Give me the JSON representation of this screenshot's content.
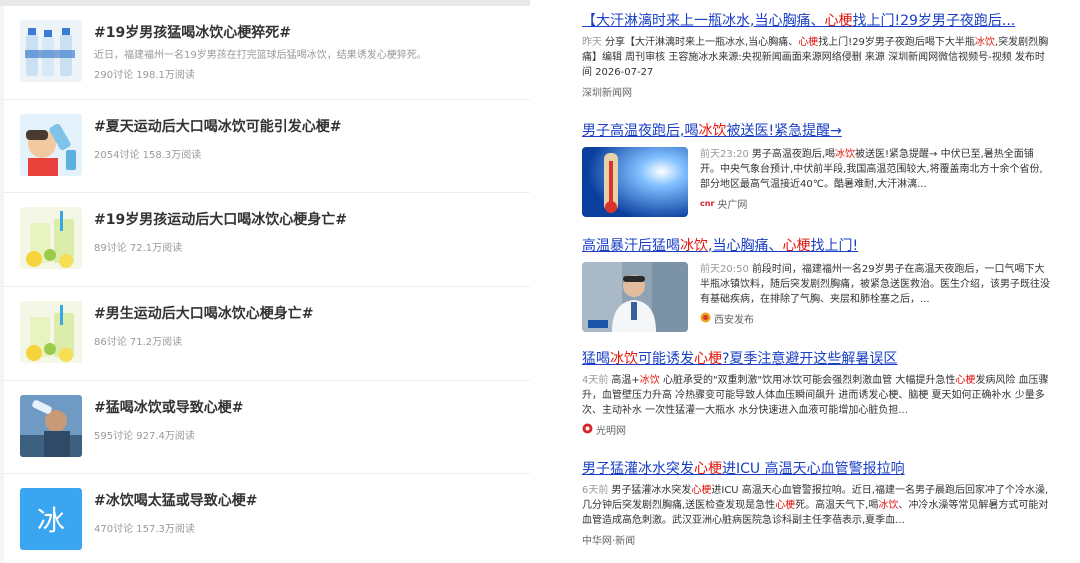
{
  "topics": [
    {
      "title": "#19岁男孩猛喝冰饮心梗猝死#",
      "desc": "近日，福建福州一名19岁男孩在打完篮球后猛喝冰饮，结果诱发心梗猝死。",
      "stats": "290讨论 198.1万阅读",
      "thumb": "water-bottles"
    },
    {
      "title": "#夏天运动后大口喝冰饮可能引发心梗#",
      "desc": "",
      "stats": "2054讨论 158.3万阅读",
      "thumb": "drinking-illustration"
    },
    {
      "title": "#19岁男孩运动后大口喝冰饮心梗身亡#",
      "desc": "",
      "stats": "89讨论 72.1万阅读",
      "thumb": "lemonade"
    },
    {
      "title": "#男生运动后大口喝冰饮心梗身亡#",
      "desc": "",
      "stats": "86讨论 71.2万阅读",
      "thumb": "lemonade"
    },
    {
      "title": "#猛喝冰饮或导致心梗#",
      "desc": "",
      "stats": "595讨论 927.4万阅读",
      "thumb": "man-drinking"
    },
    {
      "title": "#冰饮喝太猛或导致心梗#",
      "desc": "",
      "stats": "470讨论 157.3万阅读",
      "thumb": "ice-char",
      "thumb_char": "冰"
    }
  ],
  "news": [
    {
      "title_parts": [
        "【大汗淋漓时来上一瓶冰水,当心胸痛、",
        "心梗",
        "找上门!29岁男子夜跑后..."
      ],
      "time": "昨天",
      "body_parts": [
        "分享【大汗淋漓时来上一瓶冰水,当心胸痛、",
        "心梗",
        "找上门!29岁男子夜跑后喝下大半瓶",
        "冰饮",
        ",突发剧烈胸痛】编辑 周刊审核 王容施冰水来源:央视新闻画面来源网络侵删 来源 深圳新闻网微信视频号-视频 发布时间 2026-07-27"
      ],
      "source": "深圳新闻网"
    },
    {
      "title_parts": [
        "男子高温夜跑后,喝",
        "冰饮",
        "被送医!紧急提醒→"
      ],
      "time": "前天23:20",
      "body_parts": [
        "男子高温夜跑后,喝",
        "冰饮",
        "被送医!紧急提醒→ 中伏已至,暑热全面铺开。中央气象台预计,中伏前半段,我国高温范围较大,将覆盖南北方十余个省份,部分地区最高气温接近40℃。酷暑难耐,大汗淋漓..."
      ],
      "source": "央广网",
      "source_badge": "cnr",
      "image": "thermometer"
    },
    {
      "title_parts": [
        "高温暴汗后猛喝",
        "冰饮",
        ",当心胸痛、",
        "心梗",
        "找上门!"
      ],
      "time": "前天20:50",
      "body_parts": [
        "前段时间，福建福州一名29岁男子在高温天夜跑后，一口气喝下大半瓶冰镇饮料，随后突发剧烈胸痛，被紧急送医救治。医生介绍，该男子既往没有基础疾病，在排除了气胸、夹层和肺栓塞之后，..."
      ],
      "source": "西安发布",
      "image": "doctor"
    },
    {
      "title_parts": [
        "猛喝",
        "冰饮",
        "可能诱发",
        "心梗",
        "?夏季注意避开这些解暑误区"
      ],
      "time": "4天前",
      "body_parts": [
        "高温+",
        "冰饮",
        " 心脏承受的\"双重刺激\"饮用冰饮可能会强烈刺激血管 大幅提升急性",
        "心梗",
        "发病风险 血压骤升，血管壁压力升高 冷热骤变可能导致人体血压瞬间飙升 进而诱发心梗、脑梗 夏天如何正确补水 少量多次、主动补水 一次性猛灌一大瓶水 水分快速进入血液可能增加心脏负担..."
      ],
      "source": "光明网",
      "source_badge": "gmw"
    },
    {
      "title_parts": [
        "男子猛灌冰水突发",
        "心梗",
        "进ICU 高温天心血管警报拉响"
      ],
      "time": "6天前",
      "body_parts": [
        "男子猛灌冰水突发",
        "心梗",
        "进ICU 高温天心血管警报拉响。近日,福建一名男子晨跑后回家冲了个冷水澡,几分钟后突发剧烈胸痛,送医检查发现是急性",
        "心梗",
        "死。高温天气下,喝",
        "冰饮",
        "、冲冷水澡等常见解暑方式可能对血管造成高危刺激。武汉亚洲心脏病医院急诊科副主任李蓓表示,夏季血..."
      ],
      "source": "中华网·新闻"
    }
  ],
  "colors": {
    "link": "#1a3fc4",
    "highlight": "#e3170d",
    "muted": "#999999"
  }
}
